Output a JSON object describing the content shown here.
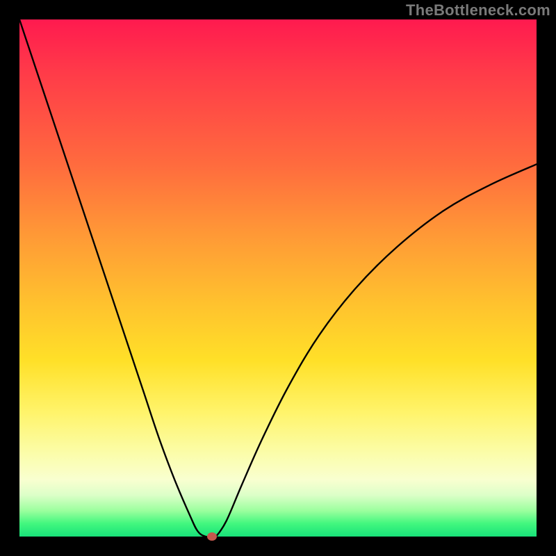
{
  "watermark": "TheBottleneck.com",
  "chart_data": {
    "type": "line",
    "title": "",
    "xlabel": "",
    "ylabel": "",
    "xlim": [
      0,
      100
    ],
    "ylim": [
      0,
      100
    ],
    "series": [
      {
        "name": "bottleneck-curve",
        "x": [
          0,
          3,
          6,
          9,
          12,
          15,
          18,
          21,
          24,
          27,
          30,
          33,
          34.5,
          36,
          37.5,
          38,
          40,
          43,
          47,
          52,
          58,
          65,
          73,
          82,
          91,
          100
        ],
        "values": [
          100,
          91,
          82,
          73,
          64,
          55,
          46,
          37,
          28,
          19,
          11,
          4,
          1,
          0,
          0,
          0,
          3,
          10,
          19,
          29,
          39,
          48,
          56,
          63,
          68,
          72
        ]
      }
    ],
    "marker": {
      "x": 37.2,
      "y": 0
    },
    "background_gradient": {
      "direction": "vertical",
      "stops": [
        {
          "pos": 0.0,
          "color": "#ff1a4f"
        },
        {
          "pos": 0.42,
          "color": "#ff9a36"
        },
        {
          "pos": 0.66,
          "color": "#ffe028"
        },
        {
          "pos": 0.89,
          "color": "#f9ffd0"
        },
        {
          "pos": 1.0,
          "color": "#18e27a"
        }
      ]
    },
    "colors": {
      "curve": "#000000",
      "marker": "#c4584d",
      "frame": "#000000"
    }
  }
}
